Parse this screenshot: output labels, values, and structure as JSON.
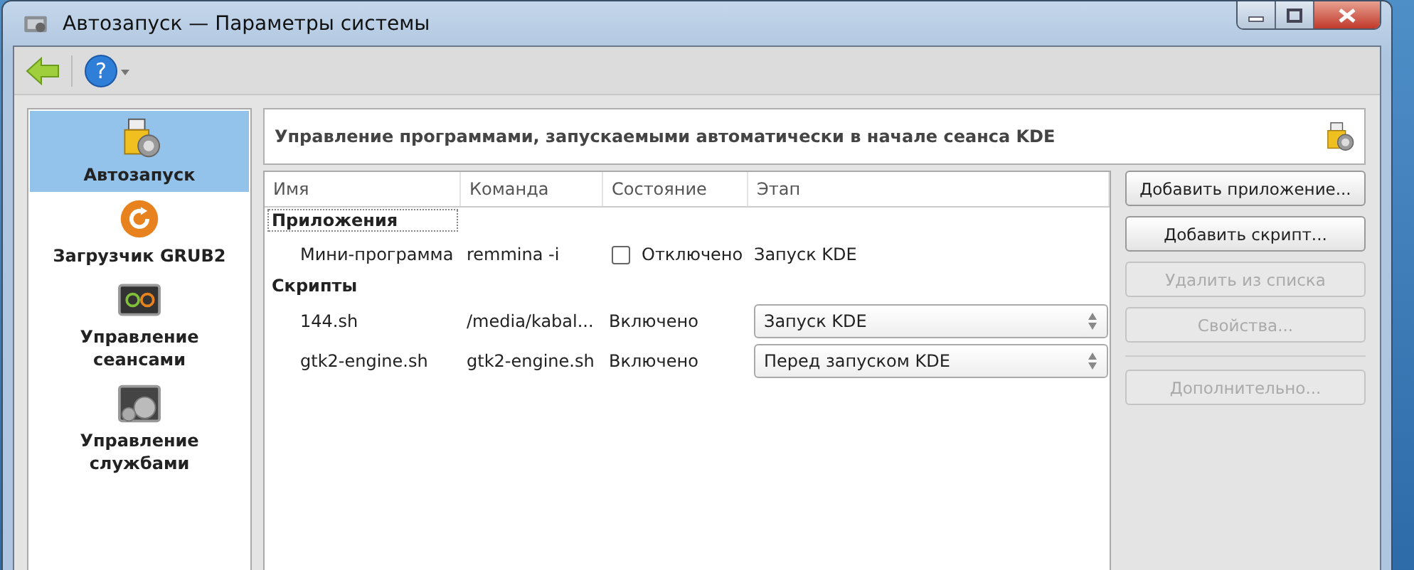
{
  "window": {
    "title": "Автозапуск — Параметры системы"
  },
  "toolbar": {
    "help": "?"
  },
  "sidebar": {
    "items": [
      {
        "label": "Автозапуск",
        "selected": true
      },
      {
        "label": "Загрузчик GRUB2",
        "selected": false
      },
      {
        "label": "Управление сеансами",
        "selected": false
      },
      {
        "label": "Управление службами",
        "selected": false
      }
    ]
  },
  "header": {
    "title": "Управление программами, запускаемыми автоматически в начале сеанса KDE"
  },
  "table": {
    "columns": [
      "Имя",
      "Команда",
      "Состояние",
      "Этап"
    ],
    "groups": [
      {
        "label": "Приложения",
        "focused": true,
        "rows": [
          {
            "kind": "application",
            "name": "Мини-программа",
            "command": "remmina -i",
            "checked": false,
            "status": "Отключено",
            "stage": "Запуск KDE"
          }
        ]
      },
      {
        "label": "Скрипты",
        "focused": false,
        "rows": [
          {
            "kind": "script",
            "name": "144.sh",
            "command": "/media/kabal...",
            "status": "Включено",
            "stage": "Запуск KDE"
          },
          {
            "kind": "script",
            "name": "gtk2-engine.sh",
            "command": "gtk2-engine.sh",
            "status": "Включено",
            "stage": "Перед запуском KDE"
          }
        ]
      }
    ]
  },
  "button_groups": [
    [
      {
        "label": "Добавить приложение...",
        "disabled": false
      },
      {
        "label": "Добавить скрипт...",
        "disabled": false
      },
      {
        "label": "Удалить из списка",
        "disabled": true
      },
      {
        "label": "Свойства...",
        "disabled": true
      }
    ],
    [
      {
        "label": "Дополнительно...",
        "disabled": true
      }
    ]
  ]
}
